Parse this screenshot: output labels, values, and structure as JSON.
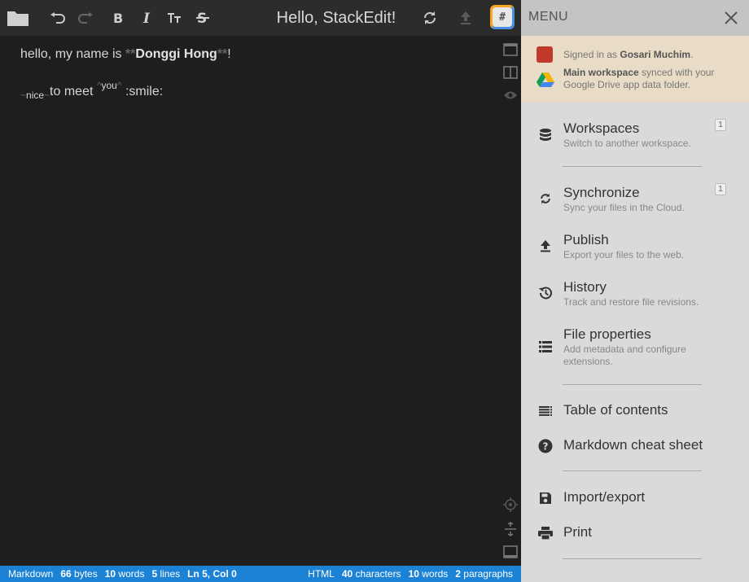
{
  "navbar": {
    "title": "Hello, StackEdit!",
    "logo_glyph": "#",
    "icons": [
      "folder-icon",
      "undo-icon",
      "redo-icon",
      "bold-icon",
      "italic-icon",
      "heading-icon",
      "strikethrough-icon",
      "sync-icon",
      "publish-icon"
    ]
  },
  "editor": {
    "line1": {
      "text": "hello, my name is ",
      "bold_open": "**",
      "bold_text": "Donggi Hong",
      "bold_close": "**",
      "tail": "!"
    },
    "line2": {
      "sub_open": "~",
      "sub_text": "nice",
      "sub_close": "~",
      "mid": "to meet ",
      "sup_open": "^",
      "sup_text": "you",
      "sup_close": "^",
      "tail": " :smile:"
    }
  },
  "statusbar": {
    "left": [
      {
        "label": "Markdown",
        "value": ""
      },
      {
        "value": "66",
        "label": " bytes"
      },
      {
        "value": "10",
        "label": " words"
      },
      {
        "value": "5",
        "label": " lines"
      },
      {
        "value": "Ln 5, Col 0",
        "label": ""
      }
    ],
    "right": [
      {
        "label": "HTML",
        "value": ""
      },
      {
        "value": "40",
        "label": " characters"
      },
      {
        "value": "10",
        "label": " words"
      },
      {
        "value": "2",
        "label": " paragraphs"
      }
    ]
  },
  "menu": {
    "title": "MENU",
    "signin": {
      "line1_prefix": "Signed in as ",
      "user": "Gosari Muchim",
      "line1_suffix": ".",
      "workspace_bold": "Main workspace",
      "workspace_rest": " synced with your Google Drive app data folder."
    },
    "items": {
      "workspaces": {
        "label": "Workspaces",
        "desc": "Switch to another workspace.",
        "badge": "1"
      },
      "synchronize": {
        "label": "Synchronize",
        "desc": "Sync your files in the Cloud.",
        "badge": "1"
      },
      "publish": {
        "label": "Publish",
        "desc": "Export your files to the web."
      },
      "history": {
        "label": "History",
        "desc": "Track and restore file revisions."
      },
      "file_properties": {
        "label": "File properties",
        "desc": "Add metadata and configure extensions."
      },
      "toc": {
        "label": "Table of contents"
      },
      "cheatsheet": {
        "label": "Markdown cheat sheet"
      },
      "import_export": {
        "label": "Import/export"
      },
      "print": {
        "label": "Print"
      }
    }
  },
  "colors": {
    "accent": "#1c82d6",
    "signin_bg": "#e8dcc6",
    "menu_bg": "#dadada",
    "editor_bg": "#1e1e1e"
  }
}
